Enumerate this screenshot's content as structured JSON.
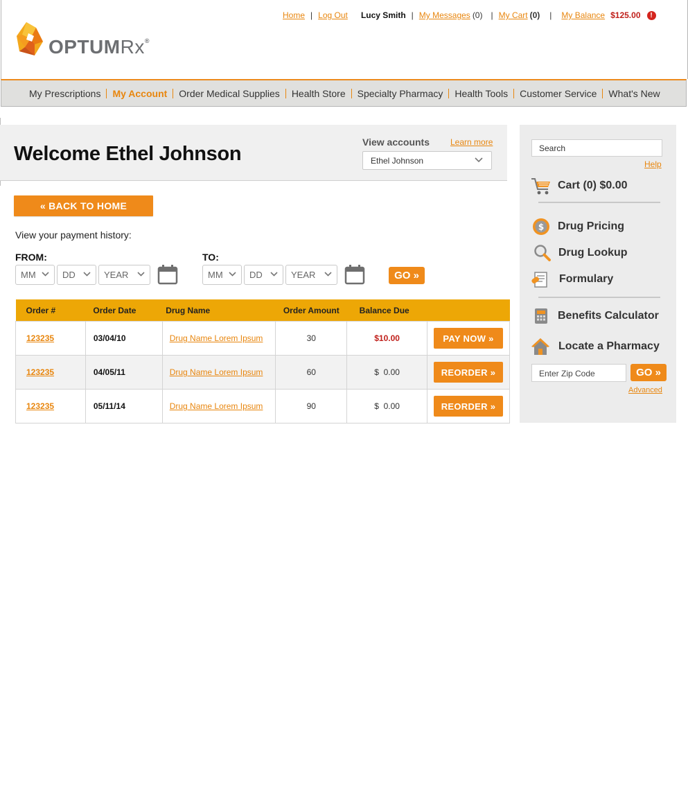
{
  "brand": {
    "name_bold": "OPTUM",
    "name_light": "Rx",
    "reg_mark": "®"
  },
  "utility_nav": {
    "home": "Home",
    "logout": "Log Out",
    "user_name": "Lucy Smith",
    "messages_label": "My Messages",
    "messages_count": "(0)",
    "cart_label": "My Cart",
    "cart_count": "(0)",
    "balance_label": "My Balance",
    "balance_amount": "$125.00",
    "alert_glyph": "!"
  },
  "main_nav": [
    {
      "label": "My Prescriptions"
    },
    {
      "label": "My Account"
    },
    {
      "label": "Order Medical Supplies"
    },
    {
      "label": "Health Store"
    },
    {
      "label": "Specialty Pharmacy"
    },
    {
      "label": "Health Tools"
    },
    {
      "label": "Customer Service"
    },
    {
      "label": "What's New"
    }
  ],
  "welcome": {
    "title": "Welcome Ethel Johnson",
    "view_accounts_label": "View accounts",
    "learn_more": "Learn more",
    "selected_account": "Ethel Johnson"
  },
  "back_button": "« BACK TO HOME",
  "history": {
    "label": "View your payment history:",
    "from_label": "FROM:",
    "to_label": "TO:",
    "month_placeholder": "MM",
    "day_placeholder": "DD",
    "year_placeholder": "YEAR",
    "go_label": "GO »"
  },
  "orders_table": {
    "headers": [
      "Order #",
      "Order Date",
      "Drug Name",
      "Order Amount",
      "Balance Due",
      ""
    ],
    "rows": [
      {
        "order_id": "123235",
        "date": "03/04/10",
        "drug": "Drug Name Lorem Ipsum",
        "amount": "30",
        "balance": "$10.00",
        "action": "PAY NOW »"
      },
      {
        "order_id": "123235",
        "date": "04/05/11",
        "drug": "Drug Name Lorem Ipsum",
        "amount": "60",
        "balance": "$  0.00",
        "action": "REORDER »"
      },
      {
        "order_id": "123235",
        "date": "05/11/14",
        "drug": "Drug Name Lorem Ipsum",
        "amount": "90",
        "balance": "$  0.00",
        "action": "REORDER »"
      }
    ]
  },
  "sidebar": {
    "search_placeholder": "Search",
    "help": "Help",
    "cart_summary": "Cart (0) $0.00",
    "drug_pricing": "Drug Pricing",
    "drug_lookup": "Drug Lookup",
    "formulary": "Formulary",
    "benefits_calculator": "Benefits Calculator",
    "locate_pharmacy": "Locate a Pharmacy",
    "zip_placeholder": "Enter Zip Code",
    "go_label": "GO »",
    "advanced": "Advanced"
  },
  "colors": {
    "accent": "#ef8a1a",
    "table_header": "#eda706",
    "alert_red": "#c0201b",
    "nav_bg": "#e0e0de"
  },
  "icons": [
    "logo-mark-icon",
    "alert-icon",
    "chevron-down-icon",
    "calendar-icon",
    "cart-icon",
    "dollar-coin-icon",
    "magnifier-icon",
    "formulary-doc-icon",
    "calculator-icon",
    "house-icon"
  ]
}
